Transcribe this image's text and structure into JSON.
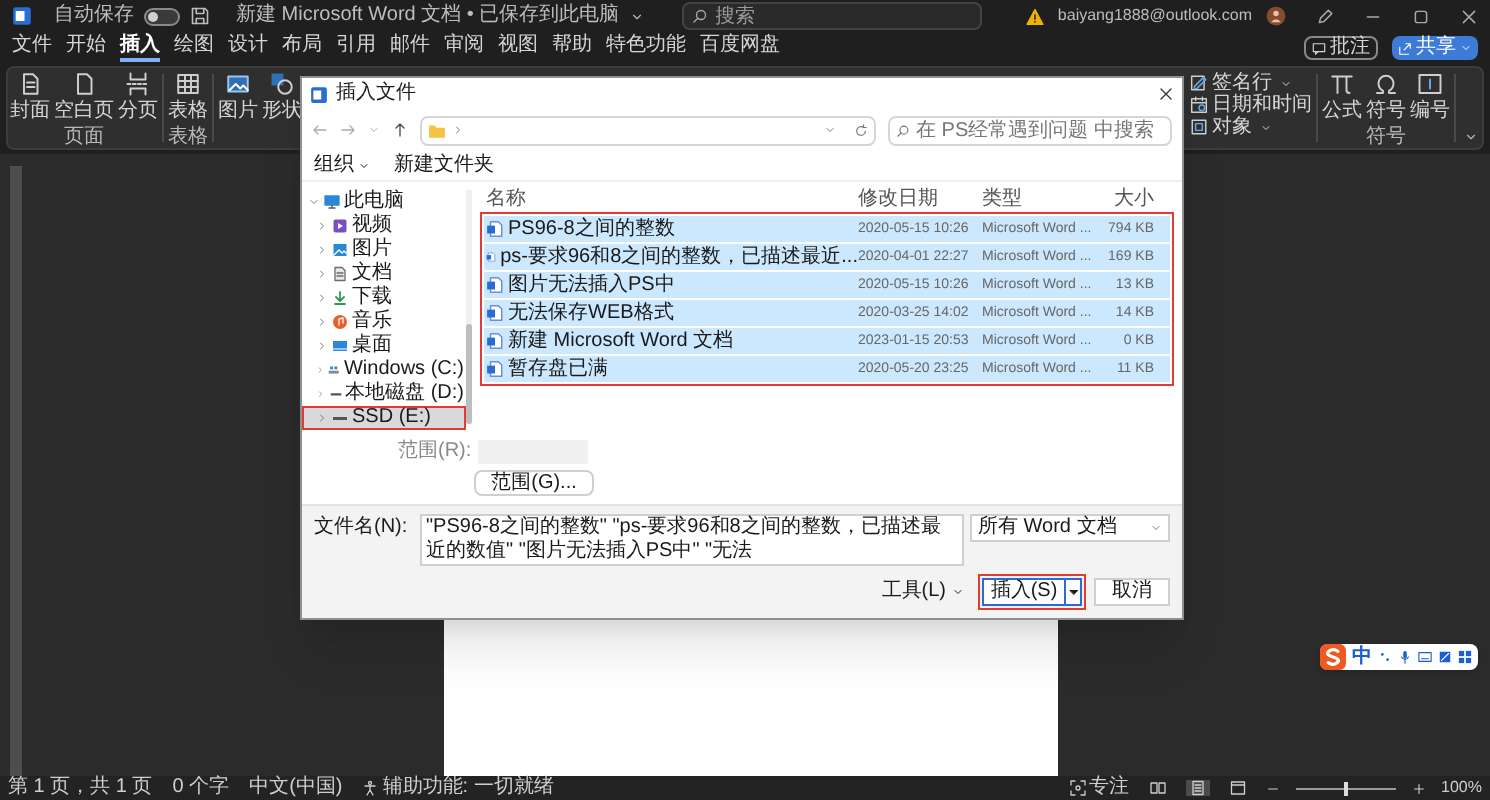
{
  "title_bar": {
    "autosave_label": "自动保存",
    "autosave_on": false,
    "document_title": "新建 Microsoft Word 文档 • 已保存到此电脑",
    "search_placeholder": "搜索",
    "account": "baiyang1888@outlook.com"
  },
  "menu": [
    {
      "label": "文件",
      "selected": false
    },
    {
      "label": "开始",
      "selected": false
    },
    {
      "label": "插入",
      "selected": true
    },
    {
      "label": "绘图",
      "selected": false
    },
    {
      "label": "设计",
      "selected": false
    },
    {
      "label": "布局",
      "selected": false
    },
    {
      "label": "引用",
      "selected": false
    },
    {
      "label": "邮件",
      "selected": false
    },
    {
      "label": "审阅",
      "selected": false
    },
    {
      "label": "视图",
      "selected": false
    },
    {
      "label": "帮助",
      "selected": false
    },
    {
      "label": "特色功能",
      "selected": false
    },
    {
      "label": "百度网盘",
      "selected": false
    }
  ],
  "comment_button": "批注",
  "share_button": "共享",
  "ribbon_left": [
    {
      "label": "页面",
      "items": [
        {
          "label": "封面",
          "kind": "cover"
        },
        {
          "label": "空白页",
          "kind": "blank"
        },
        {
          "label": "分页",
          "kind": "break"
        }
      ]
    },
    {
      "label": "表格",
      "items": [
        {
          "label": "表格",
          "kind": "table"
        }
      ]
    },
    {
      "items": [
        {
          "label": "图片",
          "kind": "picture"
        },
        {
          "label": "形状",
          "kind": "shapes"
        }
      ]
    }
  ],
  "ribbon_text_commands": [
    {
      "label": "签名行",
      "kind": "signature",
      "menu": true
    },
    {
      "label": "日期和时间",
      "kind": "datetime",
      "menu": false
    },
    {
      "label": "对象",
      "kind": "object",
      "menu": true
    }
  ],
  "ribbon_symbols": {
    "label": "符号",
    "items": [
      {
        "label": "公式",
        "kind": "equation"
      },
      {
        "label": "符号",
        "kind": "omega"
      },
      {
        "label": "编号",
        "kind": "number"
      }
    ]
  },
  "dialog": {
    "title": "插入文件",
    "search_placeholder": "在 PS经常遇到问题 中搜索",
    "organize_button": "组织",
    "new_folder_button": "新建文件夹",
    "nav": [
      {
        "label": "此电脑",
        "kind": "pc",
        "expanded": true,
        "selected": false,
        "highlighted": false,
        "children": [
          {
            "label": "视频",
            "kind": "video",
            "expanded": false,
            "selected": false,
            "highlighted": false
          },
          {
            "label": "图片",
            "kind": "pictures",
            "expanded": false,
            "selected": false,
            "highlighted": false
          },
          {
            "label": "文档",
            "kind": "documents",
            "expanded": false,
            "selected": false,
            "highlighted": false
          },
          {
            "label": "下载",
            "kind": "downloads",
            "expanded": false,
            "selected": false,
            "highlighted": false
          },
          {
            "label": "音乐",
            "kind": "music",
            "expanded": false,
            "selected": false,
            "highlighted": false
          },
          {
            "label": "桌面",
            "kind": "desktop",
            "expanded": false,
            "selected": false,
            "highlighted": false
          },
          {
            "label": "Windows (C:)",
            "kind": "system-drive",
            "expanded": false,
            "selected": false,
            "highlighted": false
          },
          {
            "label": "本地磁盘 (D:)",
            "kind": "drive",
            "expanded": false,
            "selected": false,
            "highlighted": false
          },
          {
            "label": "SSD (E:)",
            "kind": "drive",
            "expanded": false,
            "selected": true,
            "highlighted": true
          }
        ]
      }
    ],
    "columns": [
      "名称",
      "修改日期",
      "类型",
      "大小"
    ],
    "files_highlighted": true,
    "files": [
      {
        "name": "PS96-8之间的整数",
        "modified": "2020-05-15 10:26",
        "type": "Microsoft Word ...",
        "size": "794 KB",
        "selected": true
      },
      {
        "name": "ps-要求96和8之间的整数，已描述最近...",
        "modified": "2020-04-01 22:27",
        "type": "Microsoft Word ...",
        "size": "169 KB",
        "selected": true
      },
      {
        "name": "图片无法插入PS中",
        "modified": "2020-05-15 10:26",
        "type": "Microsoft Word ...",
        "size": "13 KB",
        "selected": true
      },
      {
        "name": "无法保存WEB格式",
        "modified": "2020-03-25 14:02",
        "type": "Microsoft Word ...",
        "size": "14 KB",
        "selected": true
      },
      {
        "name": "新建 Microsoft Word 文档",
        "modified": "2023-01-15 20:53",
        "type": "Microsoft Word ...",
        "size": "0 KB",
        "selected": true
      },
      {
        "name": "暂存盘已满",
        "modified": "2020-05-20 23:25",
        "type": "Microsoft Word ...",
        "size": "11 KB",
        "selected": true
      }
    ],
    "range_label": "范围(R):",
    "range_button": "范围(G)...",
    "filename_label": "文件名(N):",
    "filename": "\"PS96-8之间的整数\" \"ps-要求96和8之间的整数，已描述最近的数值\" \"图片无法插入PS中\" \"无法",
    "file_type": "所有 Word 文档",
    "tools_button": "工具(L)",
    "insert_button": {
      "label": "插入(S)",
      "highlighted": true
    },
    "cancel_button": "取消"
  },
  "status_bar": [
    {
      "text": "第 1 页，共 1 页",
      "kind": "plain"
    },
    {
      "text": "0 个字",
      "kind": "plain"
    },
    {
      "text": "中文(中国)",
      "kind": "plain"
    },
    {
      "text": "辅助功能: 一切就绪",
      "kind": "accessibility"
    }
  ],
  "focus_button": "专注",
  "views": [
    {
      "kind": "read",
      "selected": false
    },
    {
      "kind": "print",
      "selected": true
    },
    {
      "kind": "web",
      "selected": false
    }
  ],
  "zoom": {
    "level": 0.5,
    "reading": "100%"
  },
  "ime": {
    "mode": "中"
  }
}
